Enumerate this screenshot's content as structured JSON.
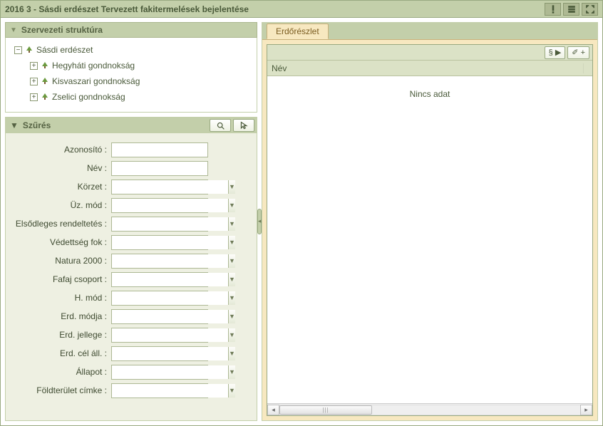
{
  "window": {
    "title": "2016 3 - Sásdi erdészet Tervezett fakitermelések bejelentése"
  },
  "org_panel": {
    "title": "Szervezeti struktúra",
    "root": "Sásdi erdészet",
    "children": [
      {
        "label": "Hegyháti gondnokság"
      },
      {
        "label": "Kisvaszari gondnokság"
      },
      {
        "label": "Zselici gondnokság"
      }
    ]
  },
  "filter_panel": {
    "title": "Szűrés",
    "fields": [
      {
        "label": "Azonosító :",
        "type": "text"
      },
      {
        "label": "Név :",
        "type": "text"
      },
      {
        "label": "Körzet :",
        "type": "combo"
      },
      {
        "label": "Üz. mód :",
        "type": "combo"
      },
      {
        "label": "Elsődleges rendeltetés :",
        "type": "combo"
      },
      {
        "label": "Védettség fok :",
        "type": "combo"
      },
      {
        "label": "Natura 2000 :",
        "type": "combo"
      },
      {
        "label": "Fafaj csoport :",
        "type": "combo"
      },
      {
        "label": "H. mód :",
        "type": "combo"
      },
      {
        "label": "Erd. módja :",
        "type": "combo"
      },
      {
        "label": "Erd. jellege :",
        "type": "combo"
      },
      {
        "label": "Erd. cél áll. :",
        "type": "combo"
      },
      {
        "label": "Állapot :",
        "type": "combo"
      },
      {
        "label": "Földterület címke :",
        "type": "combo"
      }
    ]
  },
  "main": {
    "tab_label": "Erdőrészlet",
    "toolbar": {
      "btn1": "§ ▶",
      "btn2": "✐ +"
    },
    "grid": {
      "col_name": "Név",
      "empty": "Nincs adat"
    }
  }
}
